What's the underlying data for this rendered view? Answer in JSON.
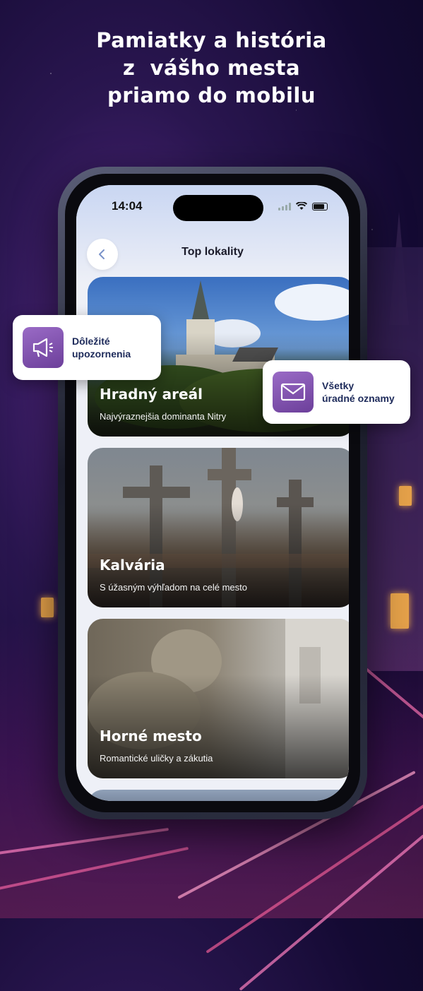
{
  "headline": {
    "line1": "Pamiatky a história",
    "line2": "z  vášho mesta",
    "line3": "priamo do mobilu"
  },
  "status_bar": {
    "time": "14:04"
  },
  "nav": {
    "title": "Top lokality",
    "back_icon": "chevron-left-icon"
  },
  "cards": [
    {
      "title": "Hradný areál",
      "subtitle": "Najvýraznejšia dominanta Nitry"
    },
    {
      "title": "Kalvária",
      "subtitle": "S úžasným výhľadom na celé mesto"
    },
    {
      "title": "Horné mesto",
      "subtitle": "Romantické uličky a zákutia"
    }
  ],
  "badges": {
    "alerts": {
      "line1": "Dôležité",
      "line2": "upozornenia",
      "icon": "megaphone-icon"
    },
    "notices": {
      "line1": "Všetky",
      "line2": "úradné oznamy",
      "icon": "envelope-icon"
    }
  },
  "colors": {
    "accent": "#7b4fb0",
    "badge_text": "#1d2a5a"
  }
}
